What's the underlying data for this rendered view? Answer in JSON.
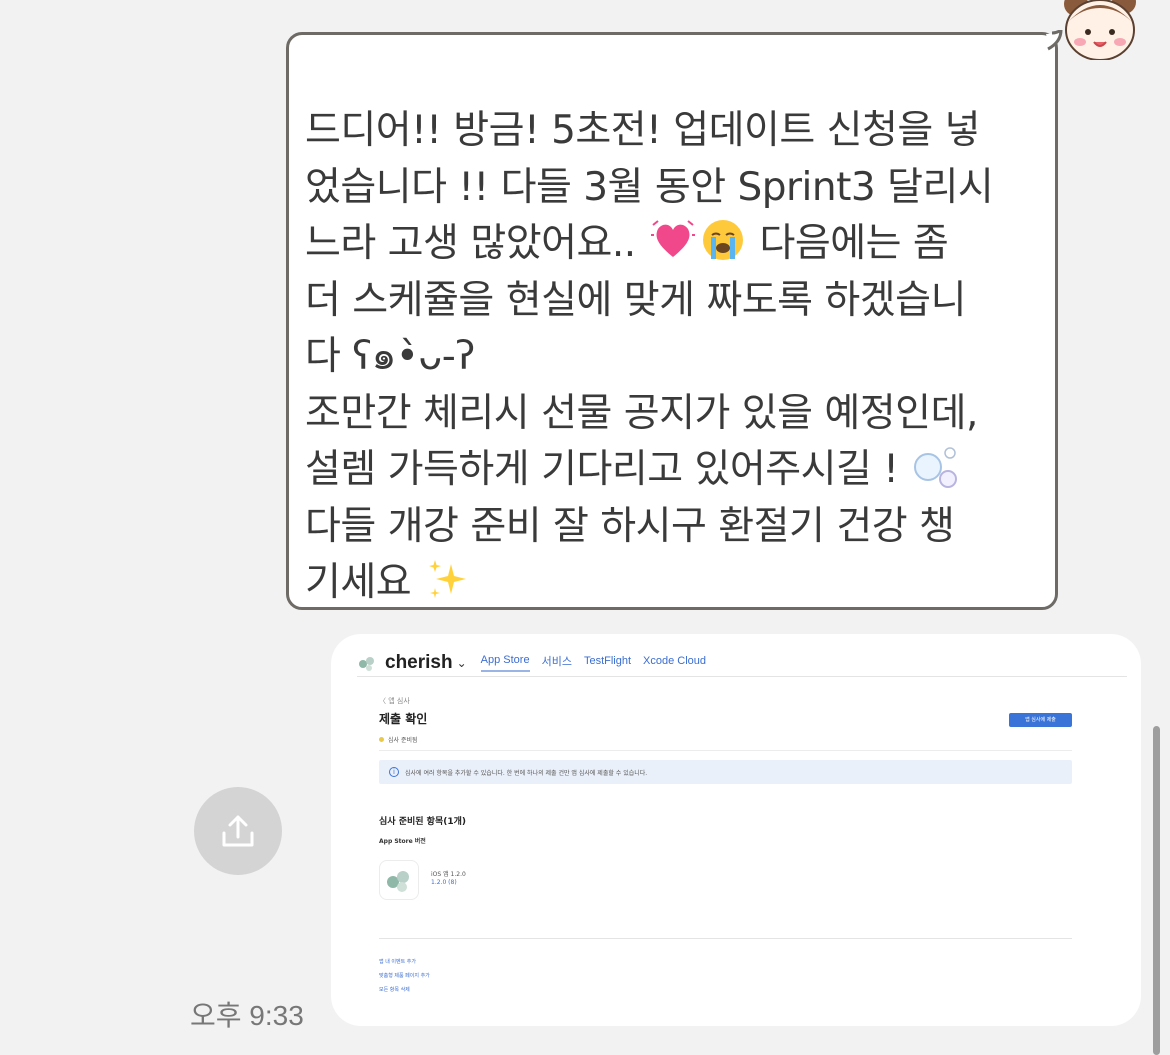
{
  "message": {
    "lines": [
      "드디어!! 방금! 5초전! 업데이트 신청을 넣",
      "었습니다 !! 다들 3월 동안 Sprint3 달리시",
      "느라 고생 많았어요..",
      "다음에는 좀",
      "더 스케쥴을 현실에 맞게 짜도록 하겠습니",
      "다 ʕ๑•̀ᴗ-ʔ",
      "조만간 체리시 선물 공지가 있을 예정인데,",
      "설렘 가득하게 기다리고 있어주시길 !",
      "다들 개강 준비 잘 하시구 환절기 건강 챙",
      "기세요"
    ],
    "emojis": [
      "heart-pulse-icon",
      "crying-face-icon",
      "bubbles-icon",
      "sparkles-icon"
    ]
  },
  "timestamp": "오후 9:33",
  "screenshot": {
    "brand": "cherish",
    "tabs": [
      "App Store",
      "서비스",
      "TestFlight",
      "Xcode Cloud"
    ],
    "active_tab": "App Store",
    "back_link": "〈 앱 심사",
    "title": "제출 확인",
    "submit_button": "앱 심사에 제출",
    "status": "심사 준비됨",
    "info": "심사에 여러 항목을 추가할 수 있습니다. 한 번에 하나의 제출 건만 앱 심사에 제출할 수 있습니다.",
    "section_title": "심사 준비된 항목(1개)",
    "section_subtitle": "App Store 버전",
    "version_platform": "iOS 앱 1.2.0",
    "version_build": "1.2.0 (8)",
    "links": [
      "앱 내 이벤트 추가",
      "맞춤형 제품 페이지 추가",
      "모든 항목 삭제"
    ]
  },
  "colors": {
    "background": "#f2f2f2",
    "bubble_border": "#6e6a66",
    "accent_blue": "#3b74d8",
    "status_yellow": "#e9c94a",
    "share_button": "#d4d4d4"
  }
}
